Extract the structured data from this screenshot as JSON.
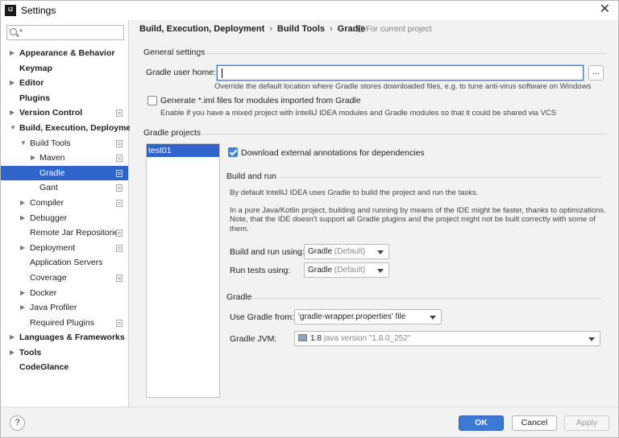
{
  "window": {
    "title": "Settings",
    "app_icon": "IJ"
  },
  "search": {
    "placeholder": ""
  },
  "tree": [
    {
      "label": "Appearance & Behavior",
      "level": 0,
      "arrow": "right",
      "bold": true
    },
    {
      "label": "Keymap",
      "level": 0,
      "arrow": "",
      "bold": true
    },
    {
      "label": "Editor",
      "level": 0,
      "arrow": "right",
      "bold": true
    },
    {
      "label": "Plugins",
      "level": 0,
      "arrow": "",
      "bold": true
    },
    {
      "label": "Version Control",
      "level": 0,
      "arrow": "right",
      "bold": true,
      "project": true
    },
    {
      "label": "Build, Execution, Deployment",
      "level": 0,
      "arrow": "down",
      "bold": true
    },
    {
      "label": "Build Tools",
      "level": 1,
      "arrow": "down",
      "project": true
    },
    {
      "label": "Maven",
      "level": 2,
      "arrow": "right",
      "project": true
    },
    {
      "label": "Gradle",
      "level": 2,
      "arrow": "",
      "project": true,
      "selected": true
    },
    {
      "label": "Gant",
      "level": 2,
      "arrow": "",
      "project": true
    },
    {
      "label": "Compiler",
      "level": 1,
      "arrow": "right",
      "project": true
    },
    {
      "label": "Debugger",
      "level": 1,
      "arrow": "right"
    },
    {
      "label": "Remote Jar Repositories",
      "level": 1,
      "arrow": "",
      "project": true
    },
    {
      "label": "Deployment",
      "level": 1,
      "arrow": "right",
      "project": true
    },
    {
      "label": "Application Servers",
      "level": 1,
      "arrow": ""
    },
    {
      "label": "Coverage",
      "level": 1,
      "arrow": "",
      "project": true
    },
    {
      "label": "Docker",
      "level": 1,
      "arrow": "right"
    },
    {
      "label": "Java Profiler",
      "level": 1,
      "arrow": "right"
    },
    {
      "label": "Required Plugins",
      "level": 1,
      "arrow": "",
      "project": true
    },
    {
      "label": "Languages & Frameworks",
      "level": 0,
      "arrow": "right",
      "bold": true
    },
    {
      "label": "Tools",
      "level": 0,
      "arrow": "right",
      "bold": true
    },
    {
      "label": "CodeGlance",
      "level": 0,
      "arrow": "",
      "bold": true
    }
  ],
  "breadcrumb": {
    "items": [
      "Build, Execution, Deployment",
      "Build Tools",
      "Gradle"
    ],
    "separator": "›",
    "for_project": "For current project"
  },
  "general": {
    "title": "General settings",
    "user_home_label": "Gradle user home:",
    "user_home_value": "",
    "browse_label": "...",
    "user_home_hint": "Override the default location where Gradle stores downloaded files, e.g. to tune anti-virus software on Windows",
    "iml_label": "Generate *.iml files for modules imported from Gradle",
    "iml_checked": false,
    "iml_hint": "Enable if you have a mixed project with IntelliJ IDEA modules and Gradle modules so that it could be shared via VCS"
  },
  "projects": {
    "title": "Gradle projects",
    "items": [
      "test01"
    ],
    "download_label": "Download external annotations for dependencies",
    "download_checked": true
  },
  "build_run": {
    "title": "Build and run",
    "desc1": "By default IntelliJ IDEA uses Gradle to build the project and run the tasks.",
    "desc2": "In a pure Java/Kotlin project, building and running by means of the IDE might be faster, thanks to optimizations.",
    "desc3": "Note, that the IDE doesn't support all Gradle plugins and the project might not be built correctly with some of",
    "desc4": "them.",
    "build_label": "Build and run using:",
    "build_value": "Gradle",
    "build_suffix": "(Default)",
    "tests_label": "Run tests using:",
    "tests_value": "Gradle",
    "tests_suffix": "(Default)"
  },
  "gradle": {
    "title": "Gradle",
    "use_from_label": "Use Gradle from:",
    "use_from_value": "'gradle-wrapper.properties' file",
    "jvm_label": "Gradle JVM:",
    "jvm_value": "1.8",
    "jvm_suffix": "java version \"1.8.0_252\""
  },
  "buttons": {
    "help": "?",
    "ok": "OK",
    "cancel": "Cancel",
    "apply": "Apply"
  },
  "colors": {
    "selection": "#2f65ca",
    "ok_button": "#3b79d3",
    "checkbox": "#3d83d8"
  }
}
